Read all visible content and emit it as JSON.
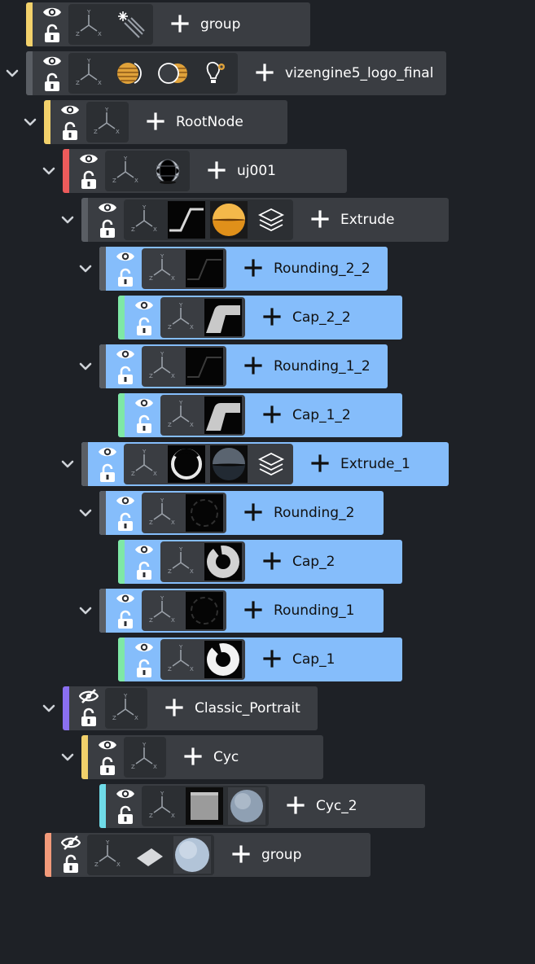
{
  "colors": {
    "background": "#1e2126",
    "row_default": "#3a3d42",
    "row_selected": "#85bdfb",
    "text_default": "#ffffff",
    "text_selected": "#101010"
  },
  "nodes": [
    {
      "label": "group",
      "color": "#f2d16b",
      "expanded": null,
      "visible": true,
      "selected": false,
      "icons": [
        "axis-icon",
        "light-rays-icon"
      ]
    },
    {
      "label": "vizengine5_logo_final",
      "color": "#5a5e64",
      "expanded": true,
      "visible": true,
      "selected": false,
      "icons": [
        "axis-icon",
        "material-icon",
        "material-alt-icon",
        "light-settings-icon"
      ]
    },
    {
      "label": "RootNode",
      "color": "#f2d16b",
      "expanded": true,
      "visible": true,
      "selected": false,
      "icons": [
        "axis-icon"
      ]
    },
    {
      "label": "uj001",
      "color": "#ec5b5b",
      "expanded": true,
      "visible": true,
      "selected": false,
      "icons": [
        "axis-icon",
        "geometry-sphere-icon"
      ]
    },
    {
      "label": "Extrude",
      "color": "#5a5e64",
      "expanded": true,
      "visible": true,
      "selected": false,
      "icons": [
        "axis-icon",
        "profile-thumb",
        "orange-ball-thumb",
        "layers-icon"
      ]
    },
    {
      "label": "Rounding_2_2",
      "color": "#5a5e64",
      "expanded": true,
      "visible": true,
      "selected": true,
      "icons": [
        "axis-icon",
        "profile-dark-thumb"
      ]
    },
    {
      "label": "Cap_2_2",
      "color": "#7ee8a6",
      "expanded": null,
      "visible": true,
      "selected": true,
      "icons": [
        "axis-icon",
        "cap-shape-thumb"
      ]
    },
    {
      "label": "Rounding_1_2",
      "color": "#5a5e64",
      "expanded": true,
      "visible": true,
      "selected": true,
      "icons": [
        "axis-icon",
        "profile-dark-thumb"
      ]
    },
    {
      "label": "Cap_1_2",
      "color": "#7ee8a6",
      "expanded": null,
      "visible": true,
      "selected": true,
      "icons": [
        "axis-icon",
        "cap-shape-thumb"
      ]
    },
    {
      "label": "Extrude_1",
      "color": "#5a5e64",
      "expanded": true,
      "visible": true,
      "selected": true,
      "icons": [
        "axis-icon",
        "ring-thumb",
        "dark-ball-thumb",
        "layers-icon"
      ]
    },
    {
      "label": "Rounding_2",
      "color": "#5a5e64",
      "expanded": true,
      "visible": true,
      "selected": true,
      "icons": [
        "axis-icon",
        "ring-dark-thumb"
      ]
    },
    {
      "label": "Cap_2",
      "color": "#7ee8a6",
      "expanded": null,
      "visible": true,
      "selected": true,
      "icons": [
        "axis-icon",
        "ring-cap-thumb"
      ]
    },
    {
      "label": "Rounding_1",
      "color": "#5a5e64",
      "expanded": true,
      "visible": true,
      "selected": true,
      "icons": [
        "axis-icon",
        "ring-dark-thumb"
      ]
    },
    {
      "label": "Cap_1",
      "color": "#7ee8a6",
      "expanded": null,
      "visible": true,
      "selected": true,
      "icons": [
        "axis-icon",
        "ring-cap-white-thumb"
      ]
    },
    {
      "label": "Classic_Portrait",
      "color": "#8a6ff0",
      "expanded": true,
      "visible": false,
      "selected": false,
      "icons": [
        "axis-icon"
      ]
    },
    {
      "label": "Cyc",
      "color": "#f2d16b",
      "expanded": true,
      "visible": true,
      "selected": false,
      "icons": [
        "axis-icon"
      ]
    },
    {
      "label": "Cyc_2",
      "color": "#6fdbe8",
      "expanded": null,
      "visible": true,
      "selected": false,
      "icons": [
        "axis-icon",
        "grey-box-thumb",
        "grey-ball-thumb"
      ]
    },
    {
      "label": "group",
      "color": "#f29a7a",
      "expanded": null,
      "visible": false,
      "selected": false,
      "icons": [
        "axis-icon",
        "plane-icon",
        "pale-ball-thumb"
      ]
    }
  ]
}
